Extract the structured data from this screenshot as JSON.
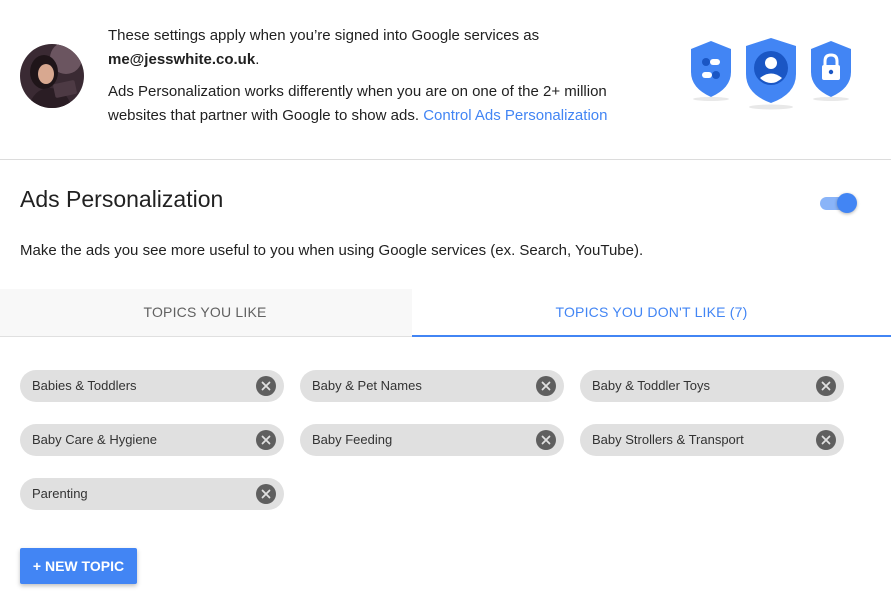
{
  "header": {
    "line1": "These settings apply when you’re signed into Google services as",
    "email": "me@jesswhite.co.uk",
    "email_suffix": ".",
    "line2": "Ads Personalization works differently when you are on one of the 2+ million websites that partner with Google to show ads.",
    "control_link": "Control Ads Personalization",
    "shield_icons": [
      "settings-shield-icon",
      "account-shield-icon",
      "lock-shield-icon"
    ]
  },
  "section": {
    "title": "Ads Personalization",
    "toggle_on": true,
    "description": "Make the ads you see more useful to you when using Google services (ex. Search, YouTube)."
  },
  "tabs": [
    {
      "label": "TOPICS YOU LIKE",
      "active": false
    },
    {
      "label": "TOPICS YOU DON'T LIKE (7)",
      "active": true
    }
  ],
  "topics": [
    "Babies & Toddlers",
    "Baby & Pet Names",
    "Baby & Toddler Toys",
    "Baby Care & Hygiene",
    "Baby Feeding",
    "Baby Strollers & Transport",
    "Parenting"
  ],
  "new_topic_label": "+ NEW TOPIC",
  "colors": {
    "accent": "#4285f4",
    "chip_bg": "#e0e0e0",
    "chip_remove": "#5f5f5f"
  }
}
